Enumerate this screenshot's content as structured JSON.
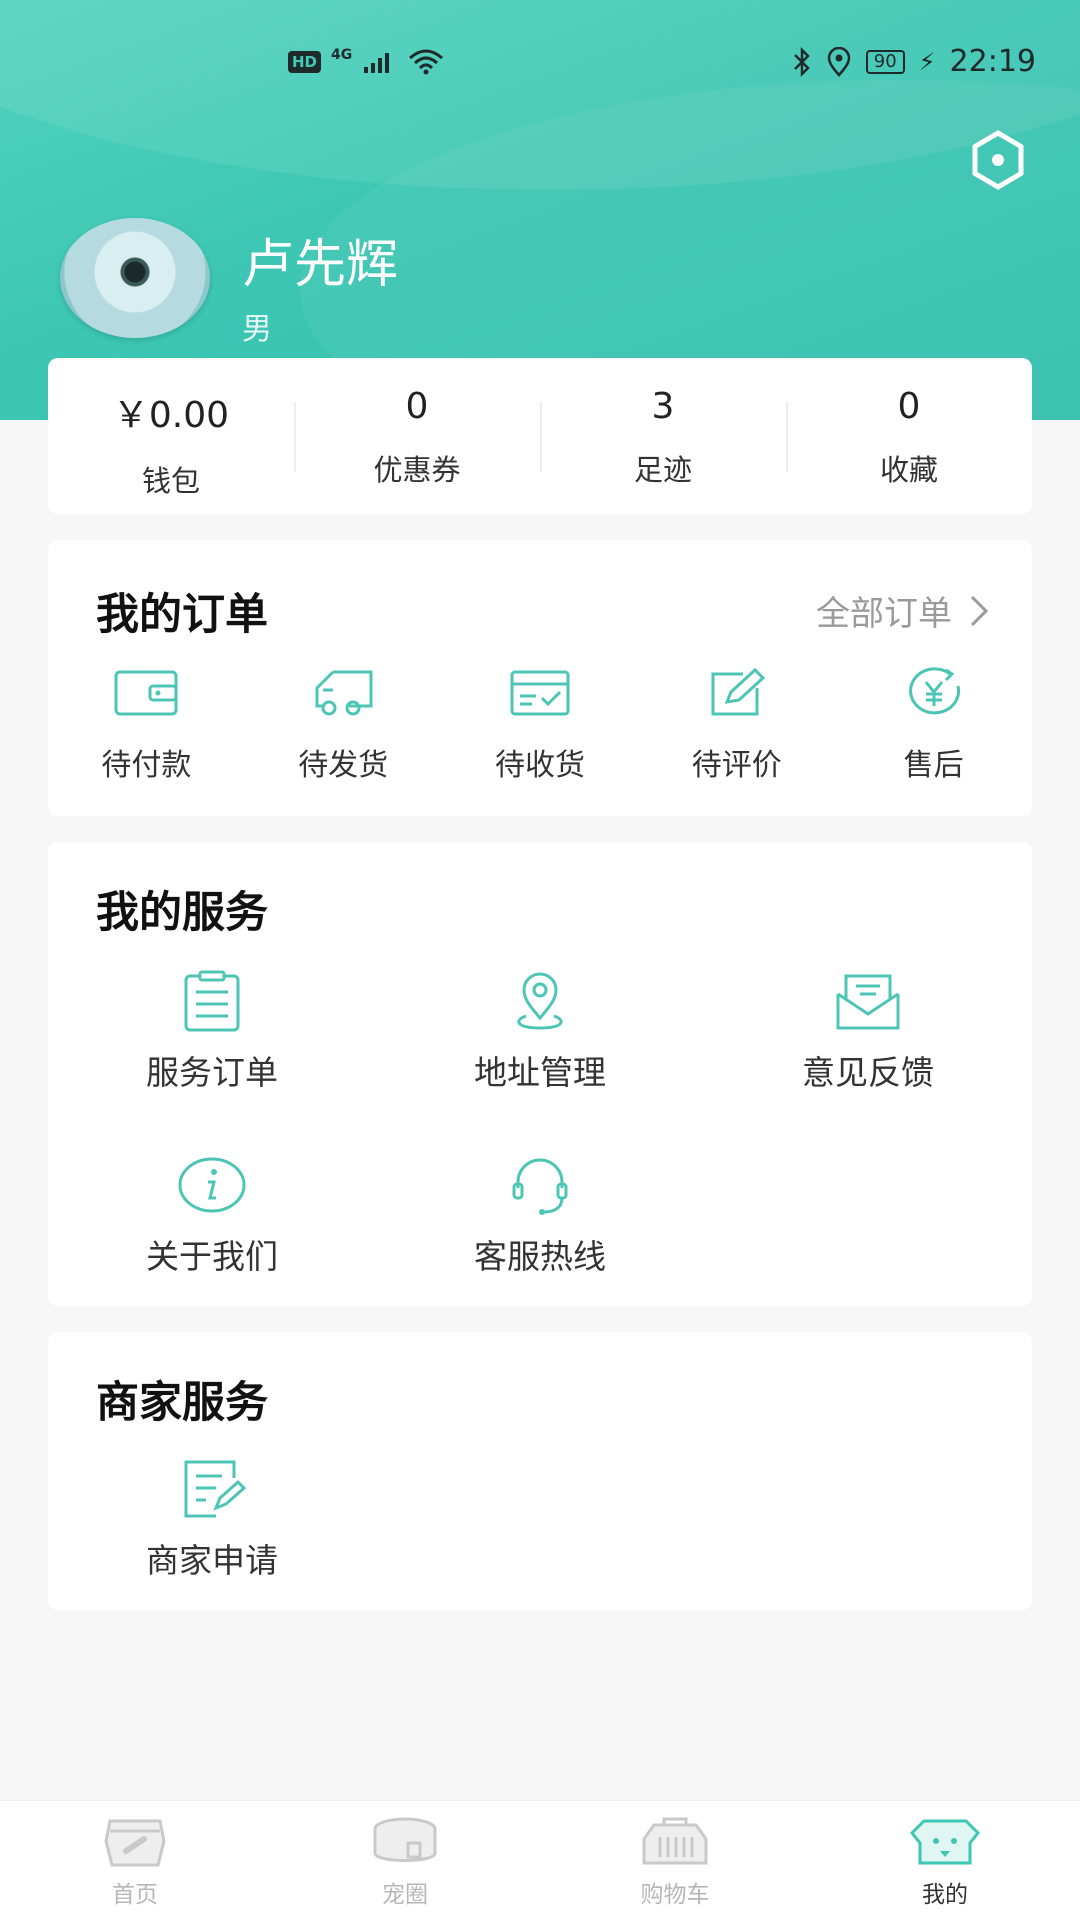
{
  "status_bar": {
    "left_badges": [
      "HD",
      "4G"
    ],
    "time": "22:19",
    "battery": "90"
  },
  "profile": {
    "name": "卢先辉",
    "gender": "男"
  },
  "stats": [
    {
      "value": "￥0.00",
      "label": "钱包"
    },
    {
      "value": "0",
      "label": "优惠券"
    },
    {
      "value": "3",
      "label": "足迹"
    },
    {
      "value": "0",
      "label": "收藏"
    }
  ],
  "orders": {
    "title": "我的订单",
    "all_label": "全部订单",
    "items": [
      {
        "label": "待付款",
        "icon": "wallet-icon"
      },
      {
        "label": "待发货",
        "icon": "truck-icon"
      },
      {
        "label": "待收货",
        "icon": "package-check-icon"
      },
      {
        "label": "待评价",
        "icon": "edit-icon"
      },
      {
        "label": "售后",
        "icon": "refund-yen-icon"
      }
    ]
  },
  "services": {
    "title": "我的服务",
    "items": [
      {
        "label": "服务订单",
        "icon": "clipboard-icon"
      },
      {
        "label": "地址管理",
        "icon": "location-pin-icon"
      },
      {
        "label": "意见反馈",
        "icon": "mail-open-icon"
      },
      {
        "label": "关于我们",
        "icon": "info-icon"
      },
      {
        "label": "客服热线",
        "icon": "headset-icon"
      }
    ]
  },
  "merchant": {
    "title": "商家服务",
    "items": [
      {
        "label": "商家申请",
        "icon": "document-edit-icon"
      }
    ]
  },
  "tabbar": [
    {
      "label": "首页",
      "icon": "home-bone-icon",
      "active": false
    },
    {
      "label": "宠圈",
      "icon": "pet-bed-icon",
      "active": false
    },
    {
      "label": "购物车",
      "icon": "pet-carrier-icon",
      "active": false
    },
    {
      "label": "我的",
      "icon": "dog-face-icon",
      "active": true
    }
  ],
  "colors": {
    "accent": "#4cc5b4",
    "header": "#3cc6b3",
    "tab_inactive": "#b7b7b7"
  }
}
